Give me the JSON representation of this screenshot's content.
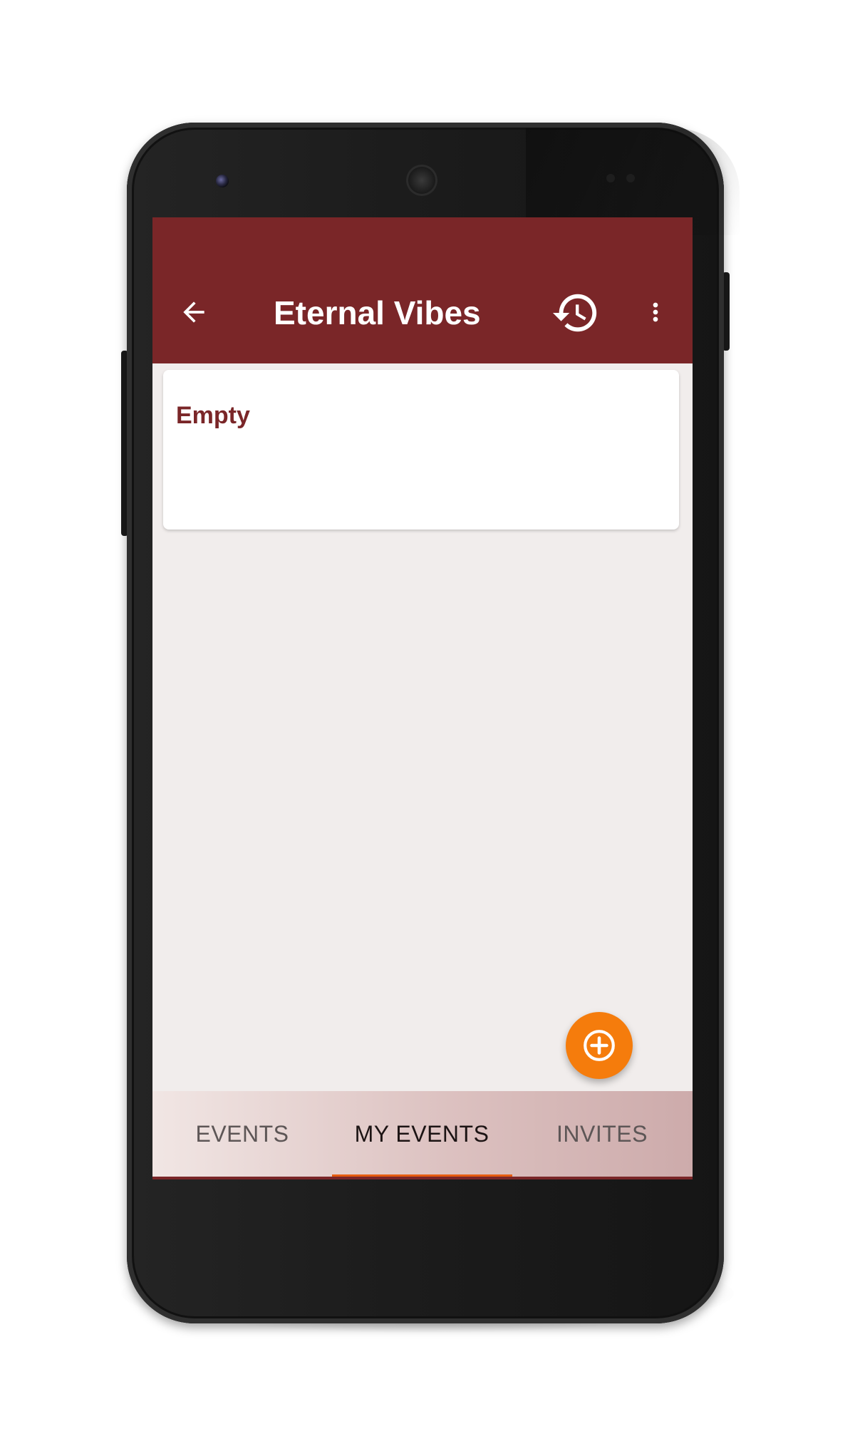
{
  "app_bar": {
    "title": "Eternal Vibes",
    "background_color": "#7a2628",
    "back_icon": "arrow-left-icon",
    "history_icon": "history-icon",
    "overflow_icon": "more-vert-icon"
  },
  "card": {
    "empty_text": "Empty"
  },
  "fab": {
    "icon": "add-circle-icon",
    "color": "#f57c0c"
  },
  "tabs": [
    {
      "label": "EVENTS",
      "active": false
    },
    {
      "label": "MY EVENTS",
      "active": true
    },
    {
      "label": "INVITES",
      "active": false
    }
  ],
  "colors": {
    "accent": "#e65c10",
    "screen_background": "#f1edec"
  }
}
